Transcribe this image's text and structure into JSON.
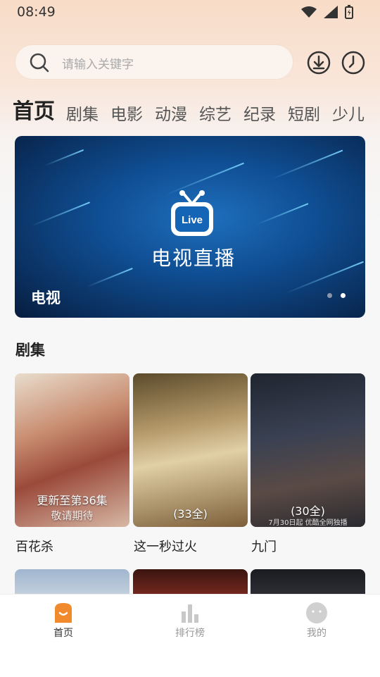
{
  "status": {
    "time": "08:49"
  },
  "search": {
    "placeholder": "请输入关键字"
  },
  "tabs": [
    "首页",
    "剧集",
    "电影",
    "动漫",
    "综艺",
    "纪录",
    "短剧",
    "少儿"
  ],
  "banner": {
    "title": "电视直播",
    "tv_label": "Live",
    "caption": "电视",
    "page": 2,
    "pages": 2
  },
  "section": {
    "title": "剧集"
  },
  "cards": [
    {
      "name": "百花杀",
      "badge": "更新至第36集",
      "overlay": "敬请期待"
    },
    {
      "name": "这一秒过火",
      "badge": "(33全)"
    },
    {
      "name": "九门",
      "badge": "(30全)",
      "overlay": "7月30日起 优酷全网独播"
    }
  ],
  "nav": [
    {
      "label": "首页",
      "icon": "home-icon",
      "active": true
    },
    {
      "label": "排行榜",
      "icon": "ranking-icon",
      "active": false
    },
    {
      "label": "我的",
      "icon": "profile-icon",
      "active": false
    }
  ],
  "colors": {
    "accent": "#f08a2c",
    "inactive": "#bbbbbb"
  }
}
